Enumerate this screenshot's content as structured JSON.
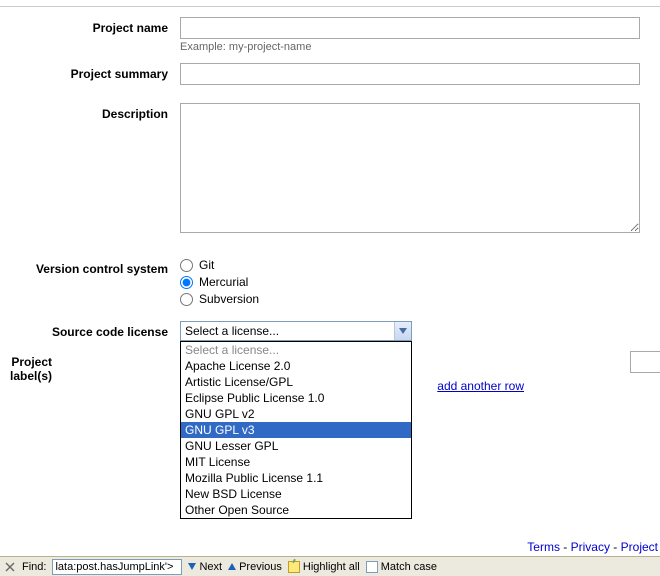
{
  "form": {
    "project_name": {
      "label": "Project name",
      "value": "",
      "hint": "Example: my-project-name"
    },
    "project_summary": {
      "label": "Project summary",
      "value": ""
    },
    "description": {
      "label": "Description",
      "value": ""
    },
    "vcs": {
      "label": "Version control system",
      "options": [
        "Git",
        "Mercurial",
        "Subversion"
      ],
      "selected": "Mercurial"
    },
    "license": {
      "label": "Source code license",
      "selected_display": "Select a license...",
      "options": [
        "Select a license...",
        "Apache License 2.0",
        "Artistic License/GPL",
        "Eclipse Public License 1.0",
        "GNU GPL v2",
        "GNU GPL v3",
        "GNU Lesser GPL",
        "MIT License",
        "Mozilla Public License 1.1",
        "New BSD License",
        "Other Open Source"
      ],
      "highlighted": "GNU GPL v3"
    },
    "project_labels": {
      "label": "Project label(s)",
      "add_link": "add another row"
    }
  },
  "footer": {
    "terms": "Terms",
    "privacy": "Privacy",
    "project": "Project",
    "sep": " - "
  },
  "findbar": {
    "label": "Find:",
    "value": "lata:post.hasJumpLink'>",
    "next": "Next",
    "previous": "Previous",
    "highlight": "Highlight all",
    "matchcase": "Match case"
  }
}
